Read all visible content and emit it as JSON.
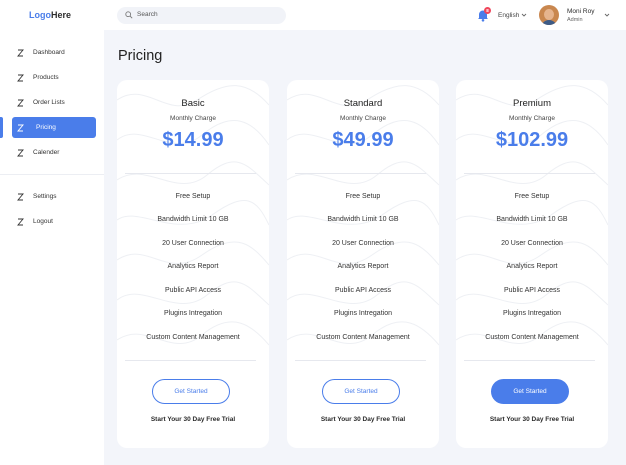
{
  "header": {
    "logo_part1": "Logo",
    "logo_part2": "Here",
    "search_placeholder": "Search",
    "notification_count": "8",
    "language": "English",
    "user_name": "Moni Roy",
    "user_role": "Admin"
  },
  "sidebar": {
    "items": [
      {
        "label": "Dashboard",
        "icon": "dashboard-icon"
      },
      {
        "label": "Products",
        "icon": "products-icon"
      },
      {
        "label": "Order Lists",
        "icon": "order-lists-icon"
      },
      {
        "label": "Pricing",
        "icon": "pricing-icon",
        "active": true
      },
      {
        "label": "Calender",
        "icon": "calendar-icon"
      },
      {
        "label": "Settings",
        "icon": "settings-icon"
      },
      {
        "label": "Logout",
        "icon": "logout-icon"
      }
    ]
  },
  "page": {
    "title": "Pricing"
  },
  "plans": [
    {
      "name": "Basic",
      "charge_label": "Monthly Charge",
      "price": "$14.99",
      "features": [
        "Free Setup",
        "Bandwidth Limit 10 GB",
        "20 User Connection",
        "Analytics Report",
        "Public API Access",
        "Plugins Intregation",
        "Custom Content Management"
      ],
      "button_label": "Get Started",
      "button_style": "outline",
      "trial_text": "Start Your 30 Day Free Trial"
    },
    {
      "name": "Standard",
      "charge_label": "Monthly Charge",
      "price": "$49.99",
      "features": [
        "Free Setup",
        "Bandwidth Limit 10 GB",
        "20 User Connection",
        "Analytics Report",
        "Public API Access",
        "Plugins Intregation",
        "Custom Content Management"
      ],
      "button_label": "Get Started",
      "button_style": "outline",
      "trial_text": "Start Your 30 Day Free Trial"
    },
    {
      "name": "Premium",
      "charge_label": "Monthly Charge",
      "price": "$102.99",
      "features": [
        "Free Setup",
        "Bandwidth Limit 10 GB",
        "20 User Connection",
        "Analytics Report",
        "Public API Access",
        "Plugins Intregation",
        "Custom Content Management"
      ],
      "button_label": "Get Started",
      "button_style": "filled",
      "trial_text": "Start Your 30 Day Free Trial"
    }
  ],
  "colors": {
    "accent": "#4a7dea",
    "background": "#f3f5fa",
    "badge": "#f0455a"
  }
}
